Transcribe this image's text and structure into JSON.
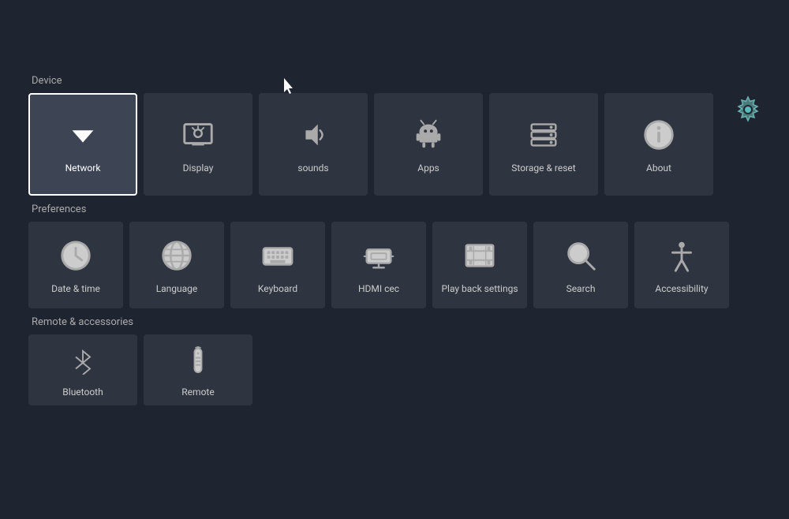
{
  "settings_icon": "gear-icon",
  "sections": {
    "device": {
      "label": "Device",
      "tiles": [
        {
          "id": "network",
          "label": "Network",
          "icon": "wifi",
          "selected": true
        },
        {
          "id": "display",
          "label": "Display",
          "icon": "display"
        },
        {
          "id": "sounds",
          "label": "sounds",
          "icon": "volume"
        },
        {
          "id": "apps",
          "label": "Apps",
          "icon": "android"
        },
        {
          "id": "storage",
          "label": "Storage & reset",
          "icon": "storage"
        },
        {
          "id": "about",
          "label": "About",
          "icon": "info"
        }
      ]
    },
    "preferences": {
      "label": "Preferences",
      "tiles": [
        {
          "id": "datetime",
          "label": "Date & time",
          "icon": "clock"
        },
        {
          "id": "language",
          "label": "Language",
          "icon": "globe"
        },
        {
          "id": "keyboard",
          "label": "Keyboard",
          "icon": "keyboard"
        },
        {
          "id": "hdmi",
          "label": "HDMI cec",
          "icon": "hdmi"
        },
        {
          "id": "playback",
          "label": "Play back settings",
          "icon": "film"
        },
        {
          "id": "search",
          "label": "Search",
          "icon": "search"
        },
        {
          "id": "accessibility",
          "label": "Accessibility",
          "icon": "accessibility"
        }
      ]
    },
    "remote": {
      "label": "Remote & accessories",
      "tiles": [
        {
          "id": "bluetooth",
          "label": "Bluetooth",
          "icon": "bluetooth"
        },
        {
          "id": "remote",
          "label": "Remote",
          "icon": "remote"
        }
      ]
    }
  }
}
